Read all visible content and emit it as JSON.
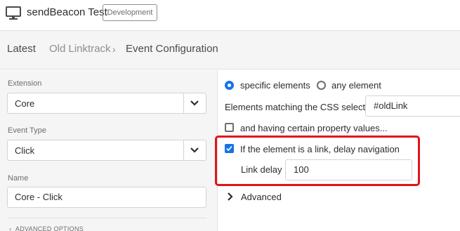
{
  "header": {
    "title": "sendBeacon Test",
    "environment": "Development",
    "icon": "monitor-icon"
  },
  "breadcrumb": {
    "items": [
      "Latest",
      "Old Linktrack",
      "Event Configuration"
    ],
    "separator": "›"
  },
  "left": {
    "extension_label": "Extension",
    "extension_value": "Core",
    "event_type_label": "Event Type",
    "event_type_value": "Click",
    "name_label": "Name",
    "name_value": "Core - Click",
    "advanced_options": "ADVANCED OPTIONS"
  },
  "right": {
    "radio_specific": "specific elements",
    "radio_any": "any element",
    "selected_radio": "specific elements",
    "css_label": "Elements matching the CSS selector",
    "css_value": "#oldLink",
    "property_checkbox": "and having certain property values...",
    "property_checked": false,
    "delay_checkbox": "If the element is a link, delay navigation",
    "delay_checked": true,
    "link_delay_label": "Link delay",
    "link_delay_value": "100",
    "advanced": "Advanced"
  },
  "colors": {
    "accent": "#1473e6",
    "highlight": "#e0141a"
  }
}
